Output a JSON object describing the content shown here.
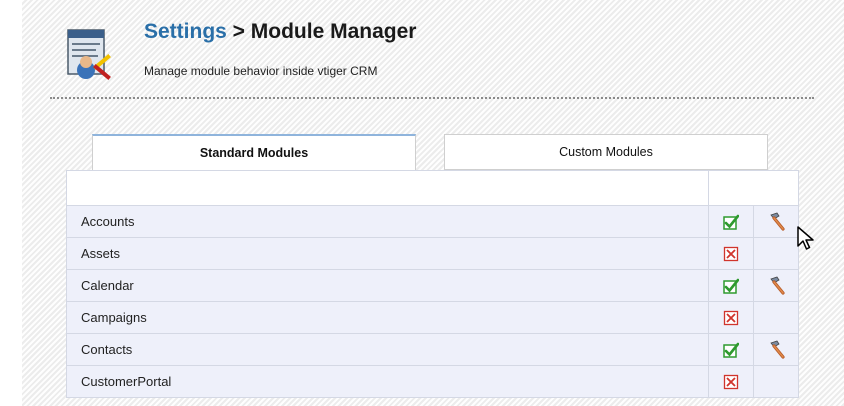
{
  "header": {
    "settings_link": "Settings",
    "separator": " > ",
    "title": "Module Manager",
    "subtitle": "Manage module behavior inside vtiger CRM",
    "icon": "settings-tools-icon"
  },
  "tabs": [
    {
      "label": "Standard Modules",
      "active": true
    },
    {
      "label": "Custom Modules",
      "active": false
    }
  ],
  "modules": [
    {
      "name": "Accounts",
      "enabled": true,
      "configurable": true
    },
    {
      "name": "Assets",
      "enabled": false,
      "configurable": false
    },
    {
      "name": "Calendar",
      "enabled": true,
      "configurable": true
    },
    {
      "name": "Campaigns",
      "enabled": false,
      "configurable": false
    },
    {
      "name": "Contacts",
      "enabled": true,
      "configurable": true
    },
    {
      "name": "CustomerPortal",
      "enabled": false,
      "configurable": false
    }
  ],
  "icons": {
    "enabled": "green-check-icon",
    "disabled": "red-x-icon",
    "configure": "hammer-icon",
    "pointer": "mouse-cursor-icon"
  },
  "colors": {
    "link": "#2a6fa8",
    "active_tab_border": "#8fb4dc",
    "row_bg": "#eef0fa",
    "check_green": "#2e9a2e",
    "x_red": "#d0342c"
  }
}
